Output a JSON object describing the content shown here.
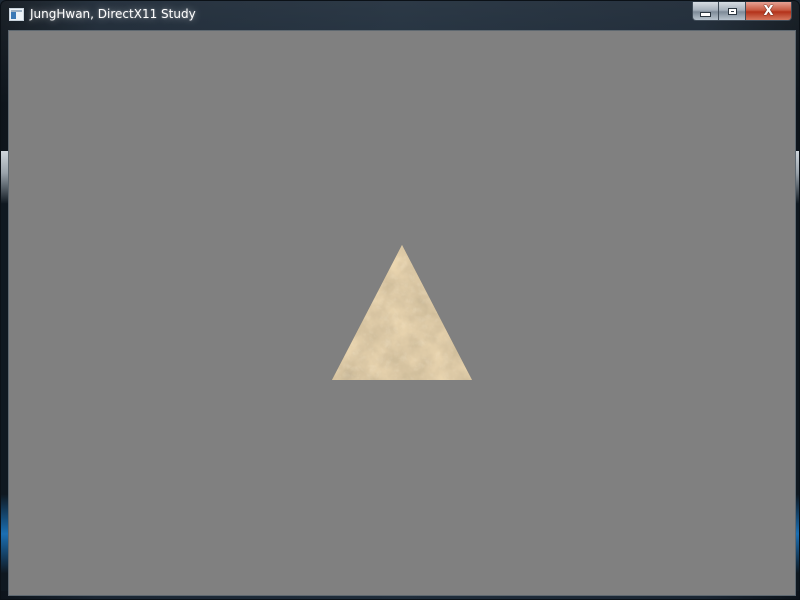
{
  "window": {
    "title": "JungHwan, DirectX11 Study",
    "app_icon": "window-app-icon",
    "controls": {
      "minimize_icon": "minimize-icon",
      "maximize_icon": "maximize-icon",
      "close_icon": "close-icon",
      "close_glyph": "X"
    }
  },
  "viewport": {
    "clear_color": "#808080",
    "mesh": {
      "shape": "triangle",
      "texture": "sandstone",
      "texture_colors": [
        "#d9c49a",
        "#b89c6a",
        "#8f7a52",
        "#efe0bf"
      ]
    }
  }
}
